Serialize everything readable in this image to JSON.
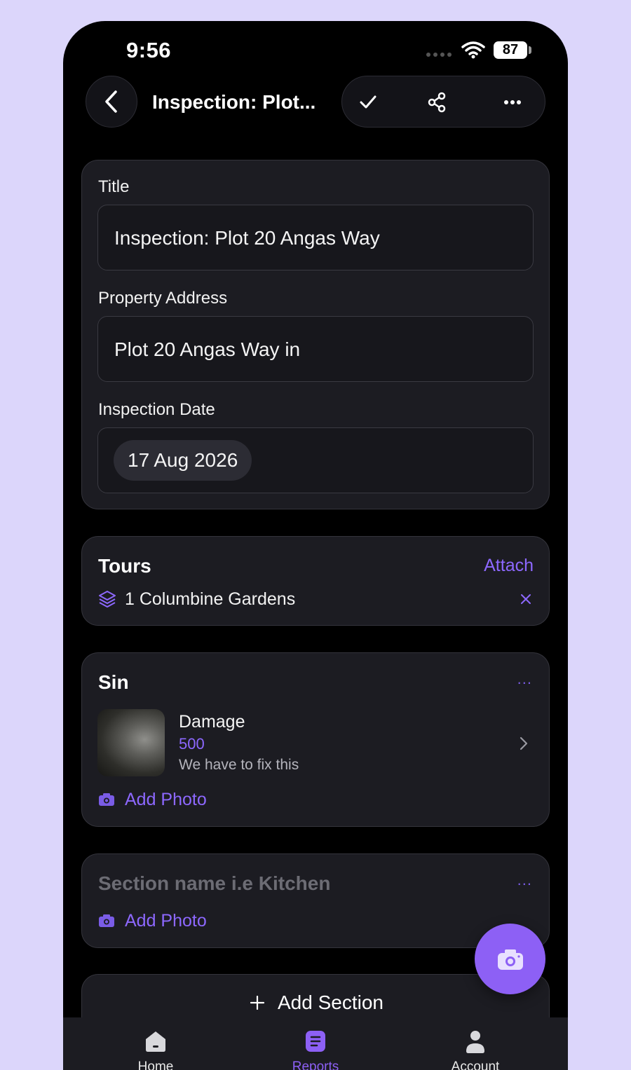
{
  "status_bar": {
    "time": "9:56",
    "battery": "87"
  },
  "header": {
    "title": "Inspection: Plot...",
    "back_icon": "chevron-left-icon",
    "actions": [
      "check-icon",
      "share-icon",
      "more-icon"
    ]
  },
  "details": {
    "title_label": "Title",
    "title_value": "Inspection: Plot 20 Angas Way",
    "address_label": "Property Address",
    "address_value": "Plot 20 Angas Way in",
    "date_label": "Inspection Date",
    "date_value": "17 Aug 2026"
  },
  "tours": {
    "heading": "Tours",
    "attach_label": "Attach",
    "items": [
      {
        "name": "1 Columbine Gardens"
      }
    ],
    "accent": "#8d68ff"
  },
  "sections": [
    {
      "name": "Sin",
      "more": "...",
      "item": {
        "title": "Damage",
        "cost": "500",
        "note": "We have to fix this"
      },
      "add_photo_label": "Add Photo"
    },
    {
      "placeholder": "Section name i.e Kitchen",
      "more": "...",
      "add_photo_label": "Add Photo"
    }
  ],
  "add_section_label": "Add Section",
  "tabbar": {
    "tabs": [
      {
        "label": "Home",
        "icon": "home-icon"
      },
      {
        "label": "Reports",
        "icon": "reports-icon",
        "active": true
      },
      {
        "label": "Account",
        "icon": "account-icon"
      }
    ]
  },
  "colors": {
    "accent": "#8d60f5",
    "background": "#000000",
    "card": "#1c1c22"
  }
}
